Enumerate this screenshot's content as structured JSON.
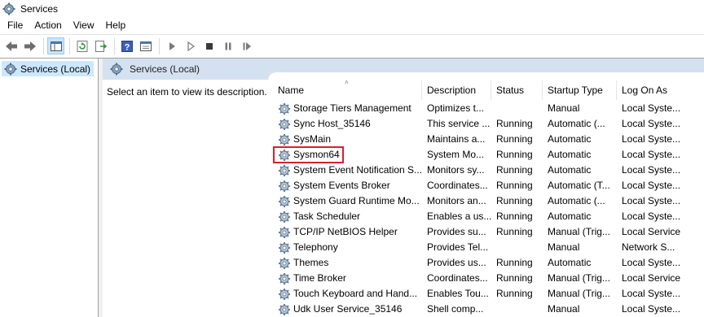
{
  "window": {
    "title": "Services",
    "icon": "services-gear-icon"
  },
  "menu": [
    "File",
    "Action",
    "View",
    "Help"
  ],
  "toolbar": {
    "buttons": [
      "back-arrow-icon",
      "forward-arrow-icon",
      "show-hide-console-tree-icon",
      "refresh-icon",
      "export-list-icon",
      "help-icon",
      "properties-icon",
      "start-service-icon",
      "start-service-alt-icon",
      "stop-service-icon",
      "pause-service-icon",
      "restart-service-icon"
    ]
  },
  "tree": {
    "selected_label": "Services (Local)"
  },
  "main": {
    "header": "Services (Local)",
    "description_hint": "Select an item to view its description."
  },
  "table": {
    "columns": [
      "Name",
      "Description",
      "Status",
      "Startup Type",
      "Log On As"
    ],
    "sort_column": "Name",
    "highlighted_service": "Sysmon64",
    "rows": [
      {
        "name": "Storage Tiers Management",
        "description": "Optimizes t...",
        "status": "",
        "startup": "Manual",
        "logon": "Local Syste..."
      },
      {
        "name": "Sync Host_35146",
        "description": "This service ...",
        "status": "Running",
        "startup": "Automatic (...",
        "logon": "Local Syste..."
      },
      {
        "name": "SysMain",
        "description": "Maintains a...",
        "status": "Running",
        "startup": "Automatic",
        "logon": "Local Syste..."
      },
      {
        "name": "Sysmon64",
        "description": "System Mo...",
        "status": "Running",
        "startup": "Automatic",
        "logon": "Local Syste..."
      },
      {
        "name": "System Event Notification S...",
        "description": "Monitors sy...",
        "status": "Running",
        "startup": "Automatic",
        "logon": "Local Syste..."
      },
      {
        "name": "System Events Broker",
        "description": "Coordinates...",
        "status": "Running",
        "startup": "Automatic (T...",
        "logon": "Local Syste..."
      },
      {
        "name": "System Guard Runtime Mo...",
        "description": "Monitors an...",
        "status": "Running",
        "startup": "Automatic (...",
        "logon": "Local Syste..."
      },
      {
        "name": "Task Scheduler",
        "description": "Enables a us...",
        "status": "Running",
        "startup": "Automatic",
        "logon": "Local Syste..."
      },
      {
        "name": "TCP/IP NetBIOS Helper",
        "description": "Provides su...",
        "status": "Running",
        "startup": "Manual (Trig...",
        "logon": "Local Service"
      },
      {
        "name": "Telephony",
        "description": "Provides Tel...",
        "status": "",
        "startup": "Manual",
        "logon": "Network S..."
      },
      {
        "name": "Themes",
        "description": "Provides us...",
        "status": "Running",
        "startup": "Automatic",
        "logon": "Local Syste..."
      },
      {
        "name": "Time Broker",
        "description": "Coordinates...",
        "status": "Running",
        "startup": "Manual (Trig...",
        "logon": "Local Service"
      },
      {
        "name": "Touch Keyboard and Hand...",
        "description": "Enables Tou...",
        "status": "Running",
        "startup": "Manual (Trig...",
        "logon": "Local Syste..."
      },
      {
        "name": "Udk User Service_35146",
        "description": "Shell comp...",
        "status": "",
        "startup": "Manual",
        "logon": "Local Syste..."
      }
    ]
  },
  "colors": {
    "highlight_border": "#d9202b",
    "header_bg": "#d4e1f0",
    "selection_bg": "#cce8ff"
  }
}
